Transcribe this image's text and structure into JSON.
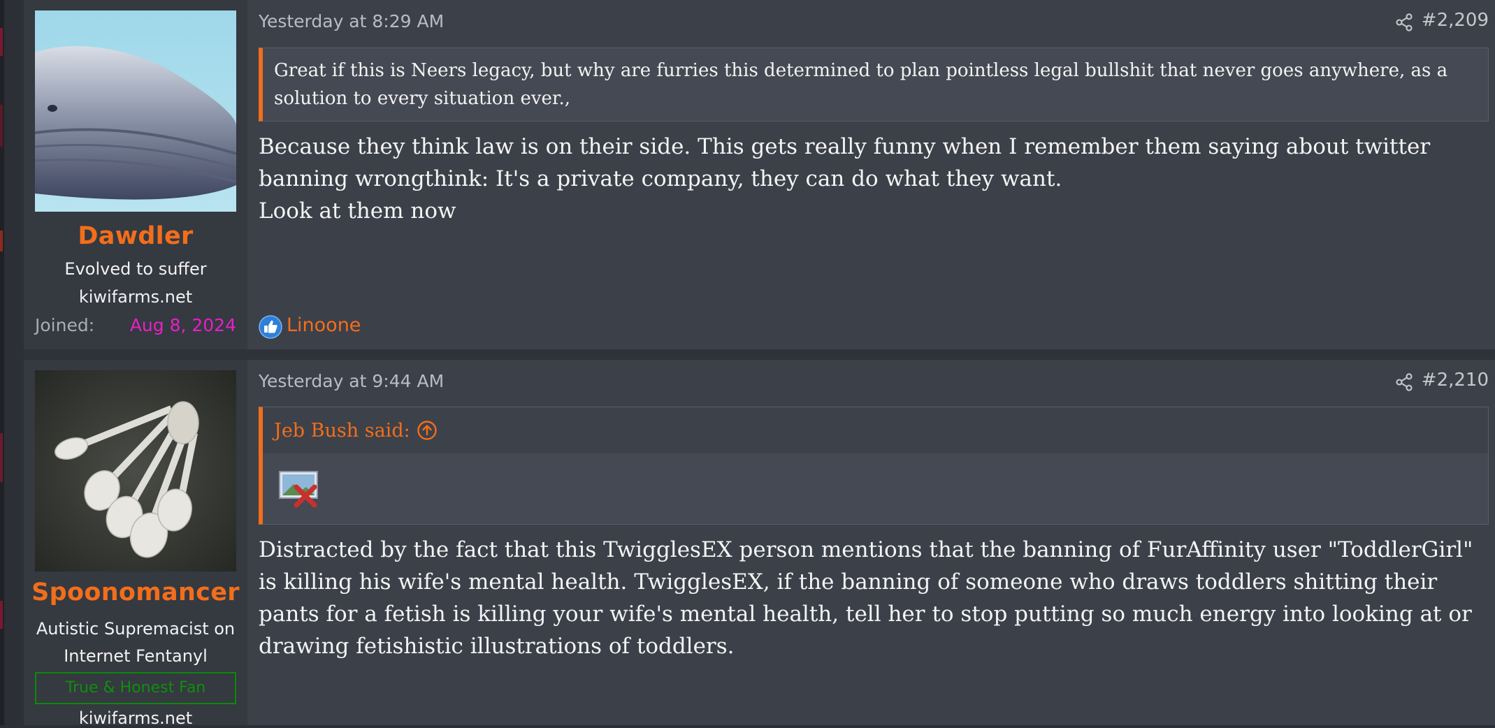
{
  "colors": {
    "accent": "#f26e1c",
    "joined_date": "#e620c8",
    "banner_green": "#0e8f0e",
    "post_bg": "#3c4049",
    "user_cell_bg": "#353940"
  },
  "posts": [
    {
      "author": {
        "name": "Dawdler",
        "title": "Evolved to suffer",
        "site": "kiwifarms.net",
        "joined_label": "Joined:",
        "joined_date": "Aug 8, 2024",
        "avatar_icon": "whale-avatar"
      },
      "date": "Yesterday at 8:29 AM",
      "number": "#2,209",
      "share_icon": "share-icon",
      "quote": {
        "text": "Great if this is Neers legacy, but why are furries this determined to plan pointless legal bullshit that never goes anywhere, as a solution to every situation ever.,"
      },
      "body": [
        "Because they think law is on their side. This gets really funny when I remember them saying about twitter banning wrongthink: It's a private company, they can do what they want.",
        "Look at them now"
      ],
      "reaction": {
        "icon": "like-icon",
        "users": "Linoone"
      }
    },
    {
      "author": {
        "name": "Spoonomancer",
        "title": "Autistic Supremacist on Internet Fentanyl",
        "banner": "True & Honest Fan",
        "site": "kiwifarms.net",
        "avatar_icon": "spoons-avatar"
      },
      "date": "Yesterday at 9:44 AM",
      "number": "#2,210",
      "share_icon": "share-icon",
      "quote": {
        "author": "Jeb Bush said:",
        "expand_icon": "arrow-up-circle-icon",
        "image_icon": "broken-image-icon"
      },
      "body": [
        "Distracted by the fact that this TwigglesEX person mentions that the banning of FurAffinity user \"ToddlerGirl\" is killing his wife's mental health. TwigglesEX, if the banning of someone who draws toddlers shitting their pants for a fetish is killing your wife's mental health, tell her to stop putting so much energy into looking at or drawing fetishistic illustrations of toddlers."
      ]
    }
  ]
}
